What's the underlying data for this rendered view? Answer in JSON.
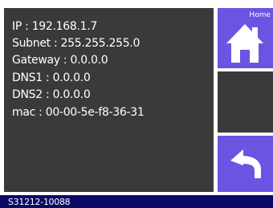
{
  "network_info": {
    "ip": "IP : 192.168.1.7",
    "subnet": "Subnet : 255.255.255.0",
    "gateway": "Gateway : 0.0.0.0",
    "dns1": "DNS1 : 0.0.0.0",
    "dns2": "DNS2 : 0.0.0.0",
    "mac": "mac : 00-00-5e-f8-36-31"
  },
  "side_buttons": {
    "home_label": "Home",
    "home_icon": "home-icon",
    "back_icon": "back-arrow-icon"
  },
  "status_bar": {
    "serial": "S31212-10088"
  },
  "colors": {
    "panel": "#3a3a3a",
    "accent": "#6a55e2",
    "status_bar": "#0a0a66",
    "text": "#ffffff"
  }
}
